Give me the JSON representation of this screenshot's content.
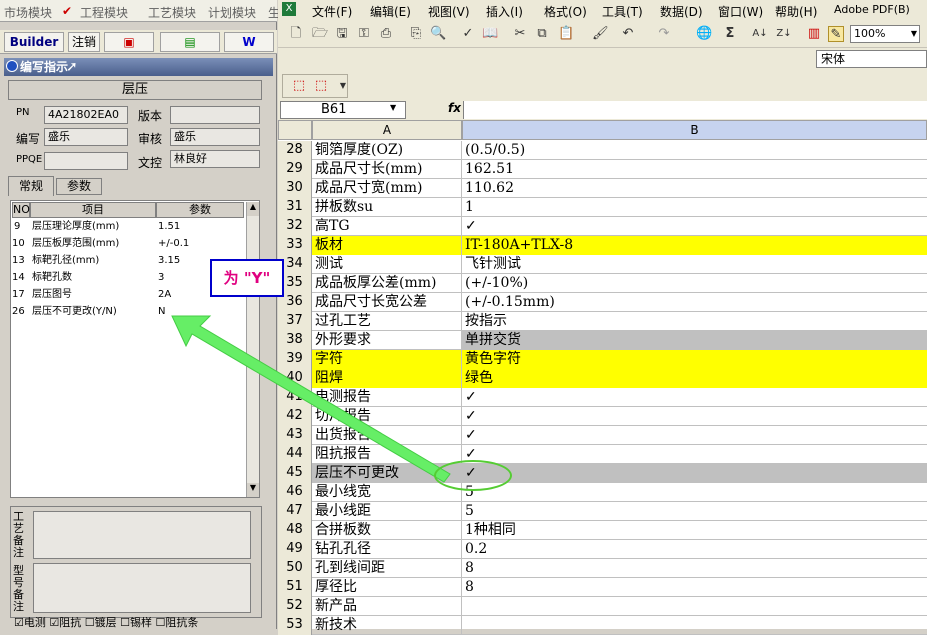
{
  "left_app": {
    "menu": [
      "市场模块",
      "工程模块",
      "工艺模块",
      "计划模块",
      "生"
    ],
    "toolbar": {
      "builder": "Builder",
      "logout": "注销",
      "w_label": "W"
    },
    "panel_title": "编写指示",
    "header": "层压",
    "fields": {
      "pn_label": "PN",
      "pn_value": "4A21802EA0",
      "version_label": "版本",
      "version_value": "",
      "writer_label": "编写",
      "writer_value": "盛乐",
      "review_label": "审核",
      "review_value": "盛乐",
      "ppqe_label": "PPQE",
      "ppqe_value": "",
      "doc_label": "文控",
      "doc_value": "林良好"
    },
    "tabs": [
      "常规",
      "参数"
    ],
    "grid": {
      "headers": [
        "NO",
        "项目",
        "参数"
      ],
      "rows": [
        {
          "no": "9",
          "item": "层压理论厚度(mm)",
          "param": "1.51"
        },
        {
          "no": "10",
          "item": "层压板厚范围(mm)",
          "param": "+/-0.1"
        },
        {
          "no": "13",
          "item": "标靶孔径(mm)",
          "param": "3.15"
        },
        {
          "no": "14",
          "item": "标靶孔数",
          "param": "3"
        },
        {
          "no": "17",
          "item": "层压图号",
          "param": "2A"
        },
        {
          "no": "26",
          "item": "层压不可更改(Y/N)",
          "param": "N"
        }
      ]
    },
    "notes": {
      "process_label": "工艺备注",
      "model_label": "型号备注"
    },
    "checkboxes": [
      "电测",
      "阻抗",
      "镀层",
      "锡样",
      "阻抗条"
    ]
  },
  "excel": {
    "menu": [
      "文件(F)",
      "编辑(E)",
      "视图(V)",
      "插入(I)",
      "格式(O)",
      "工具(T)",
      "数据(D)",
      "窗口(W)",
      "帮助(H)",
      "Adobe PDF(B)"
    ],
    "zoom": "100%",
    "font": "宋体",
    "name_box": "B61",
    "fx": "fx",
    "columns": [
      "A",
      "B"
    ],
    "rows": [
      {
        "n": "28",
        "a": "铜箔厚度(OZ)",
        "b": "(0.5/0.5)",
        "hl": ""
      },
      {
        "n": "29",
        "a": "成品尺寸长(mm)",
        "b": "162.51",
        "hl": ""
      },
      {
        "n": "30",
        "a": "成品尺寸宽(mm)",
        "b": "110.62",
        "hl": ""
      },
      {
        "n": "31",
        "a": "拼板数su",
        "b": "1",
        "hl": ""
      },
      {
        "n": "32",
        "a": "高TG",
        "b": "✓",
        "hl": ""
      },
      {
        "n": "33",
        "a": "板材",
        "b": "IT-180A+TLX-8",
        "hl": "yellow"
      },
      {
        "n": "34",
        "a": "测试",
        "b": "飞针测试",
        "hl": ""
      },
      {
        "n": "35",
        "a": "成品板厚公差(mm)",
        "b": "(+/-10%)",
        "hl": ""
      },
      {
        "n": "36",
        "a": "成品尺寸长宽公差",
        "b": "(+/-0.15mm)",
        "hl": ""
      },
      {
        "n": "37",
        "a": "过孔工艺",
        "b": "按指示",
        "hl": ""
      },
      {
        "n": "38",
        "a": "外形要求",
        "b": "单拼交货",
        "hl": "grayb"
      },
      {
        "n": "39",
        "a": "字符",
        "b": "黄色字符",
        "hl": "yellow"
      },
      {
        "n": "40",
        "a": "阻焊",
        "b": "绿色",
        "hl": "yellow"
      },
      {
        "n": "41",
        "a": "电测报告",
        "b": "✓",
        "hl": ""
      },
      {
        "n": "42",
        "a": "切片报告",
        "b": "✓",
        "hl": ""
      },
      {
        "n": "43",
        "a": "出货报告",
        "b": "✓",
        "hl": ""
      },
      {
        "n": "44",
        "a": "阻抗报告",
        "b": "✓",
        "hl": ""
      },
      {
        "n": "45",
        "a": "层压不可更改",
        "b": "✓",
        "hl": "gray"
      },
      {
        "n": "46",
        "a": "最小线宽",
        "b": "5",
        "hl": ""
      },
      {
        "n": "47",
        "a": "最小线距",
        "b": "5",
        "hl": ""
      },
      {
        "n": "48",
        "a": "合拼板数",
        "b": "1种相同",
        "hl": ""
      },
      {
        "n": "49",
        "a": "钻孔孔径",
        "b": "0.2",
        "hl": ""
      },
      {
        "n": "50",
        "a": "孔到线间距",
        "b": "8",
        "hl": ""
      },
      {
        "n": "51",
        "a": "厚径比",
        "b": "8",
        "hl": ""
      },
      {
        "n": "52",
        "a": "新产品",
        "b": "",
        "hl": ""
      },
      {
        "n": "53",
        "a": "新技术",
        "b": "",
        "hl": ""
      }
    ]
  },
  "annotation": {
    "text": "为 \"Y\""
  },
  "colors": {
    "highlight_yellow": "#ffff00",
    "highlight_gray": "#c0c0c0",
    "arrow_green": "#66ee66",
    "anno_border": "#0000cc",
    "anno_text": "#e00080"
  }
}
